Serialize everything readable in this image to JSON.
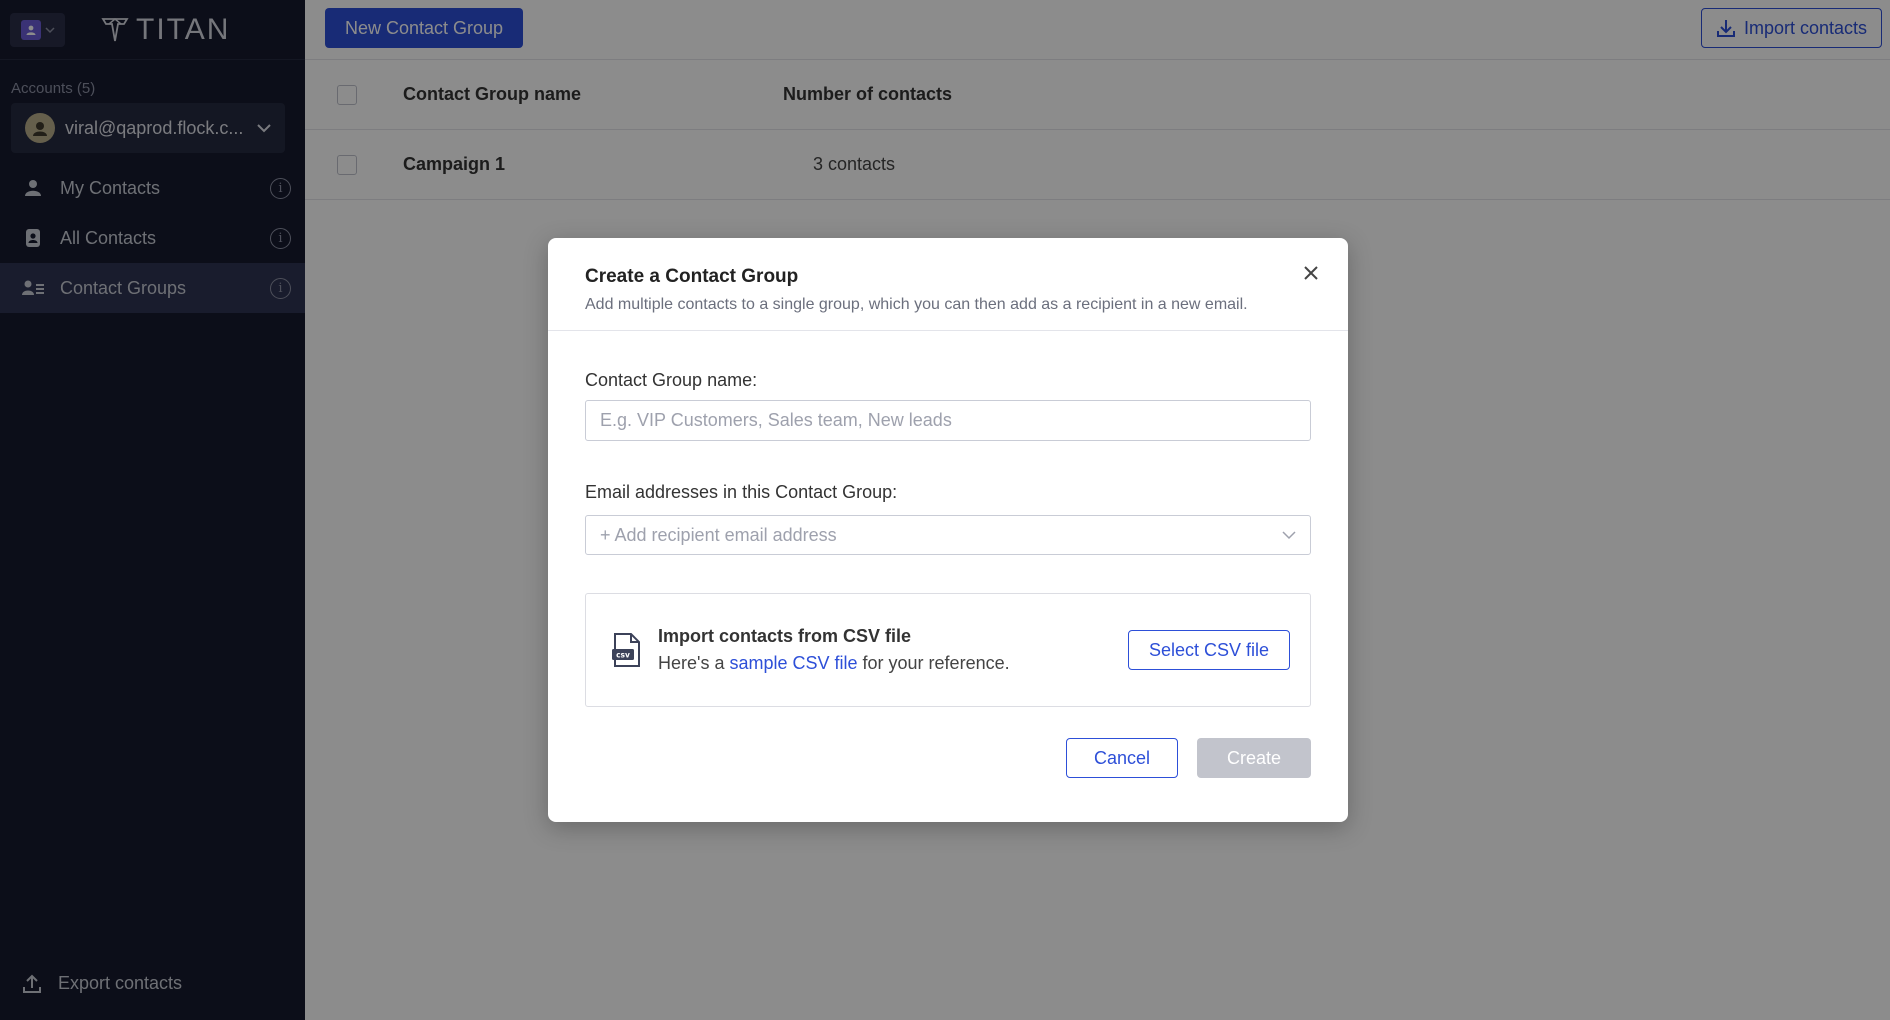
{
  "app": {
    "logo_text": "TITAN"
  },
  "sidebar": {
    "accounts_label": "Accounts (5)",
    "account_email": "viral@qaprod.flock.c...",
    "items": [
      {
        "label": "My Contacts",
        "icon": "person-icon",
        "active": false
      },
      {
        "label": "All Contacts",
        "icon": "contacts-book-icon",
        "active": false
      },
      {
        "label": "Contact Groups",
        "icon": "contact-group-icon",
        "active": true
      }
    ],
    "export_label": "Export contacts"
  },
  "toolbar": {
    "new_group_label": "New Contact Group",
    "import_label": "Import contacts"
  },
  "table": {
    "headers": {
      "name": "Contact Group name",
      "count": "Number of contacts"
    },
    "rows": [
      {
        "name": "Campaign 1",
        "count": "3 contacts"
      }
    ]
  },
  "modal": {
    "title": "Create a Contact Group",
    "subtitle": "Add multiple contacts to a single group, which you can then add as a recipient in a new email.",
    "name_label": "Contact Group name:",
    "name_placeholder": "E.g. VIP Customers, Sales team, New leads",
    "emails_label": "Email addresses in this Contact Group:",
    "emails_placeholder": "+ Add recipient email address",
    "csv": {
      "title": "Import contacts from CSV file",
      "desc_prefix": "Here's a ",
      "link_text": "sample CSV file",
      "desc_suffix": " for your reference.",
      "select_label": "Select CSV file"
    },
    "cancel_label": "Cancel",
    "create_label": "Create"
  },
  "colors": {
    "accent": "#2d4fd8",
    "sidebar_bg": "#161a2e",
    "disabled": "#c2c4cc"
  }
}
